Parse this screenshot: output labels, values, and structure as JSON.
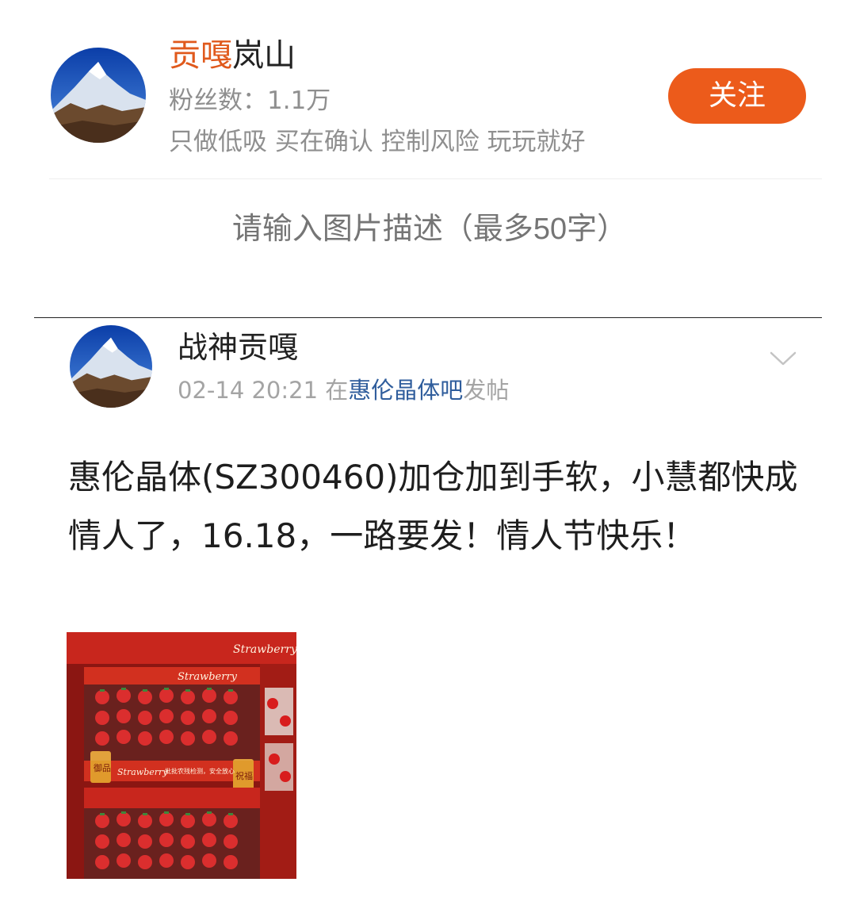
{
  "profile": {
    "name_highlight": "贡嘎",
    "name_rest": "岚山",
    "fans": "粉丝数：1.1万",
    "bio": "只做低吸 买在确认 控制风险 玩玩就好",
    "follow_label": "关注"
  },
  "caption_input": {
    "placeholder": "请输入图片描述（最多50字）"
  },
  "post": {
    "username": "战神贡嘎",
    "timestamp": "02-14 20:21",
    "meta_prefix": "在",
    "forum_name": "惠伦晶体吧",
    "meta_suffix": "发帖",
    "body": "惠伦晶体(SZ300460)加仓加到手软，小慧都快成情人了，16.18，一路要发！情人节快乐！",
    "image": {
      "label_top": "Strawberry",
      "label_mid": "Strawberry",
      "label_bottom": "Strawberry",
      "tag_left": "御品",
      "tag_right": "祝福",
      "slogan": "批批农残检测，安全放心"
    }
  },
  "colors": {
    "accent": "#ec5b1b",
    "name_highlight": "#e0591c",
    "link": "#2f5d9c",
    "muted": "#8f8f8f"
  },
  "icons": {
    "chevron": "chevron-down-icon"
  }
}
